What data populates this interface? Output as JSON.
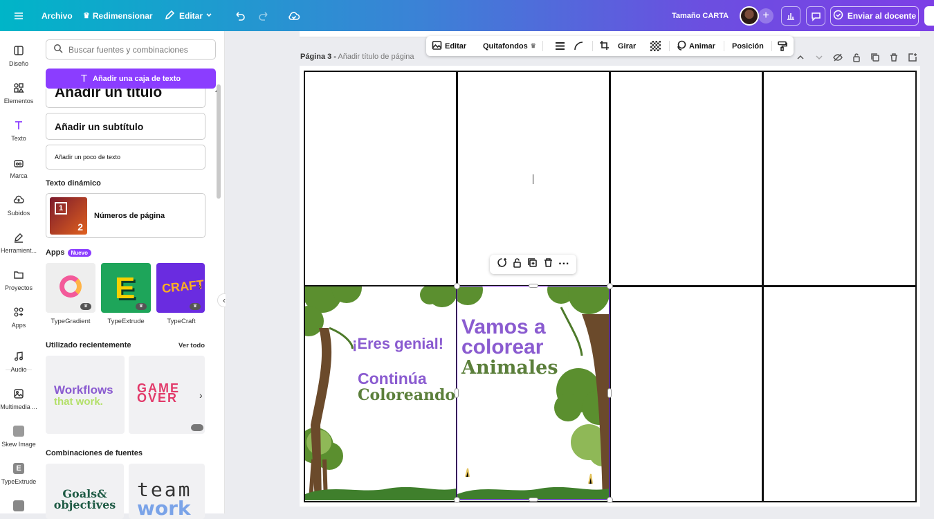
{
  "topbar": {
    "menu_icon": "hamburger-icon",
    "file": "Archivo",
    "resize": "Redimensionar",
    "edit": "Editar",
    "size": "Tamaño CARTA",
    "send": "Enviar al docente"
  },
  "rail": {
    "items": [
      {
        "label": "Diseño",
        "icon": "layout-icon"
      },
      {
        "label": "Elementos",
        "icon": "shapes-icon"
      },
      {
        "label": "Texto",
        "icon": "text-icon"
      },
      {
        "label": "Marca",
        "icon": "brand-icon"
      },
      {
        "label": "Subidos",
        "icon": "upload-icon"
      },
      {
        "label": "Herramient...",
        "icon": "pen-icon"
      },
      {
        "label": "Proyectos",
        "icon": "folder-icon"
      },
      {
        "label": "Apps",
        "icon": "apps-icon"
      },
      {
        "label": "Audio",
        "icon": "music-icon"
      },
      {
        "label": "Multimedia ...",
        "icon": "media-icon"
      },
      {
        "label": "Skew Image",
        "icon": "skew-icon"
      },
      {
        "label": "TypeExtrude",
        "icon": "typeextrude-icon"
      }
    ]
  },
  "panel": {
    "search_placeholder": "Buscar fuentes y combinaciones",
    "add_textbox": "Añadir una caja de texto",
    "heading": "Añadir un título",
    "subheading": "Añadir un subtítulo",
    "body": "Añadir un poco de texto",
    "dynamic_title": "Texto dinámico",
    "page_numbers": "Números de página",
    "apps_title": "Apps",
    "apps_badge": "Nuevo",
    "apps": [
      {
        "name": "TypeGradient"
      },
      {
        "name": "TypeExtrude"
      },
      {
        "name": "TypeCraft"
      }
    ],
    "recent_title": "Utilizado recientemente",
    "see_all": "Ver todo",
    "recent": [
      {
        "line1": "Workflows",
        "line2": "that work."
      },
      {
        "line1": "GAME",
        "line2": "OVER"
      }
    ],
    "combos_title": "Combinaciones de fuentes",
    "combos": [
      {
        "line1": "Goals&",
        "line2": "objectives"
      },
      {
        "line1": "team",
        "line2": "work"
      }
    ]
  },
  "toolbar": {
    "edit": "Editar",
    "bg_remover": "Quitafondos",
    "rotate": "Girar",
    "animate": "Animar",
    "position": "Posición"
  },
  "page": {
    "label": "Página 3 -",
    "title_placeholder": "Añadir título de página"
  },
  "canvas": {
    "back_cover": {
      "line1": "¡Eres genial!",
      "line2": "Continúa",
      "line3": "Coloreando"
    },
    "front_cover": {
      "line1": "Vamos a",
      "line2": "colorear",
      "line3": "Animales"
    }
  },
  "colors": {
    "accent": "#8b3dff",
    "purple_text": "#8a5bd0",
    "green_text": "#5b7f3b"
  }
}
